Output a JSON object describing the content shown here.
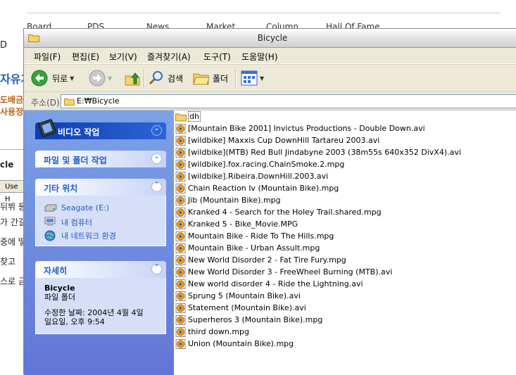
{
  "background_page": {
    "nav": [
      "Board",
      "PDS",
      "News",
      "Market",
      "Column",
      "Hall Of Fame"
    ],
    "letter": "D",
    "title": "자유게",
    "sub1": "도배금",
    "sub2": "사용정",
    "section": "cle",
    "use_box": "Use H",
    "lines": [
      "뒤뷔 등",
      "가 간길",
      "중에 떻",
      "찾고",
      "스로 금"
    ]
  },
  "window": {
    "title": "Bicycle",
    "menu": [
      "파일(F)",
      "편집(E)",
      "보기(V)",
      "즐겨찾기(A)",
      "도구(T)",
      "도움말(H)"
    ],
    "toolbar": {
      "back_label": "뒤로",
      "search_label": "검색",
      "folders_label": "폴더"
    },
    "address": {
      "label": "주소(D)",
      "value": "E:₩Bicycle"
    }
  },
  "taskpane": {
    "video_tasks": {
      "title": "비디오 작업"
    },
    "file_tasks": {
      "title": "파일 및 폴더 작업"
    },
    "other_places": {
      "title": "기타 위치",
      "items": [
        "Seagate (E:)",
        "내 컴퓨터",
        "내 네트워크 환경"
      ]
    },
    "details": {
      "title": "자세히",
      "name": "Bicycle",
      "type": "파일 폴더",
      "modified_line1": "수정한 날짜: 2004년 4월 4일",
      "modified_line2": "일요일, 오후 9:54"
    }
  },
  "files": [
    "dh",
    "[Mountain Bike 2001] Invictus Productions - Double Down.avi",
    "[wildbike] Maxxis Cup DownHill Tartareu 2003.avi",
    "[wildbike](MTB) Red Bull Jindabyne 2003 (38m55s 640x352 DivX4).avi",
    "[wildbike].fox.racing.ChainSmoke.2.mpg",
    "[wildbike].Ribeira.DownHill.2003.avi",
    "Chain Reaction Iv (Mountain Bike).mpg",
    "Jib (Mountain Bike).mpg",
    "Kranked 4 - Search for the Holey Trail.shared.mpg",
    "Kranked 5 - Bike_Movie.MPG",
    "Mountain Bike - Ride To The Hills.mpg",
    "Mountain Bike - Urban Assult.mpg",
    "New World Disorder 2 - Fat Tire Fury.mpg",
    "New World Disorder 3 - FreeWheel Burning (MTB).avi",
    "New world disorder 4 - Ride the Lightning.avi",
    "Sprung 5 (Mountain Bike).avi",
    "Statement (Mountain Bike).avi",
    "Superheros 3 (Mountain Bike).mpg",
    "third down.mpg",
    "Union (Mountain Bike).mpg"
  ]
}
